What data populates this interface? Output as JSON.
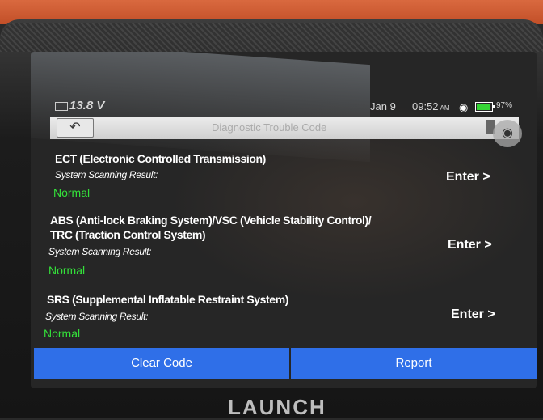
{
  "status_bar": {
    "voltage": "13.8",
    "voltage_unit": "V",
    "date": "Jan 9",
    "time": "09:52",
    "ampm": "AM",
    "battery_percent": "97%"
  },
  "header": {
    "title": "Diagnostic Trouble Code",
    "back_icon": "back-arrow-icon",
    "camera_icon": "camera-icon"
  },
  "systems": [
    {
      "name": "ECT (Electronic Controlled Transmission)",
      "result_label": "System Scanning Result:",
      "status": "Normal",
      "action": "Enter >"
    },
    {
      "name": "ABS (Anti-lock Braking System)/VSC (Vehicle Stability Control)/",
      "name_line2": "TRC (Traction Control System)",
      "result_label": "System Scanning Result:",
      "status": "Normal",
      "action": "Enter >"
    },
    {
      "name": "SRS (Supplemental Inflatable Restraint System)",
      "result_label": "System Scanning Result:",
      "status": "Normal",
      "action": "Enter >"
    }
  ],
  "footer": {
    "clear_label": "Clear Code",
    "report_label": "Report"
  },
  "brand": "LAUNCH",
  "colors": {
    "accent": "#2f6fe8",
    "status_ok": "#34e23a",
    "device_frame": "#c24f28"
  }
}
